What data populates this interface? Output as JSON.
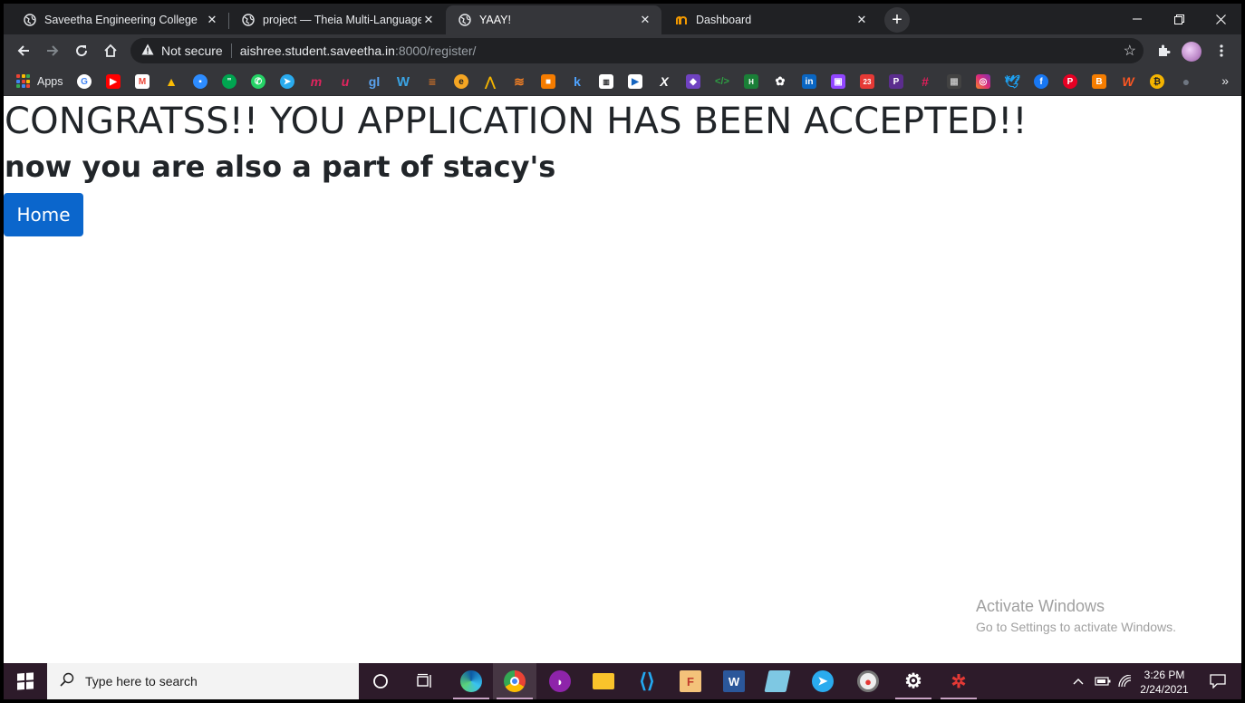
{
  "browser": {
    "tabs": [
      {
        "title": "Saveetha Engineering College",
        "icon": "globe-icon"
      },
      {
        "title": "project — Theia Multi-Language",
        "icon": "globe-icon"
      },
      {
        "title": "YAAY!",
        "icon": "globe-icon"
      },
      {
        "title": "Dashboard",
        "icon": "dashboard-favicon"
      }
    ],
    "address": {
      "security_label": "Not secure",
      "host": "aishree.student.saveetha.in",
      "path": ":8000/register/"
    },
    "bookmarks": {
      "apps_label": "Apps"
    }
  },
  "page": {
    "heading": "CONGRATSS!! YOU APPLICATION HAS BEEN ACCEPTED!!",
    "subheading": "now you are also a part of stacy's",
    "home_button": "Home"
  },
  "watermark": {
    "title": "Activate Windows",
    "subtitle": "Go to Settings to activate Windows."
  },
  "taskbar": {
    "search_placeholder": "Type here to search",
    "time": "3:26 PM",
    "date": "2/24/2021"
  },
  "colors": {
    "home_button": "#0b66cc",
    "heading_text": "#212529",
    "taskbar": "#2d1b2a",
    "browser_chrome": "#35363a"
  }
}
